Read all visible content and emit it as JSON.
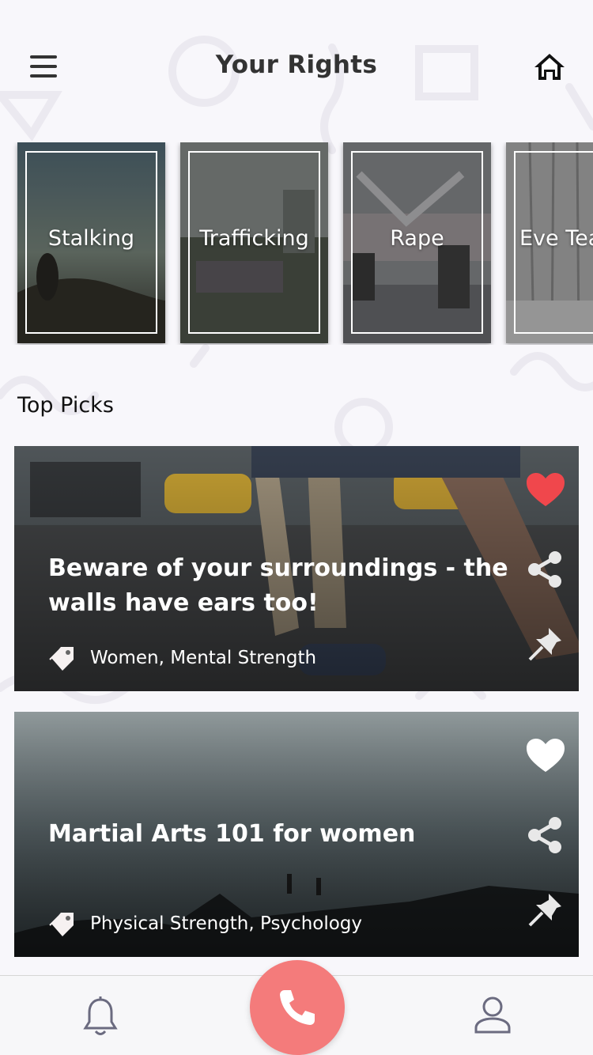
{
  "header": {
    "title": "Your Rights",
    "menu_icon": "hamburger-menu-icon",
    "home_icon": "home-icon"
  },
  "categories": [
    {
      "label": "Stalking"
    },
    {
      "label": "Trafficking"
    },
    {
      "label": "Rape"
    },
    {
      "label": "Eve Teasing"
    }
  ],
  "top_picks": {
    "title": "Top Picks",
    "items": [
      {
        "title": "Beware of your surroundings - the walls have ears too!",
        "tags": "Women, Mental Strength",
        "liked": true
      },
      {
        "title": "Martial Arts 101 for women",
        "tags": "Physical Strength, Psychology",
        "liked": false
      }
    ]
  },
  "bottom_nav": {
    "left_icon": "bell-icon",
    "center_icon": "phone-icon",
    "right_icon": "user-profile-icon"
  },
  "colors": {
    "accent": "#f47b7b",
    "like_active": "#f0474c",
    "background": "#f8f7fb"
  }
}
